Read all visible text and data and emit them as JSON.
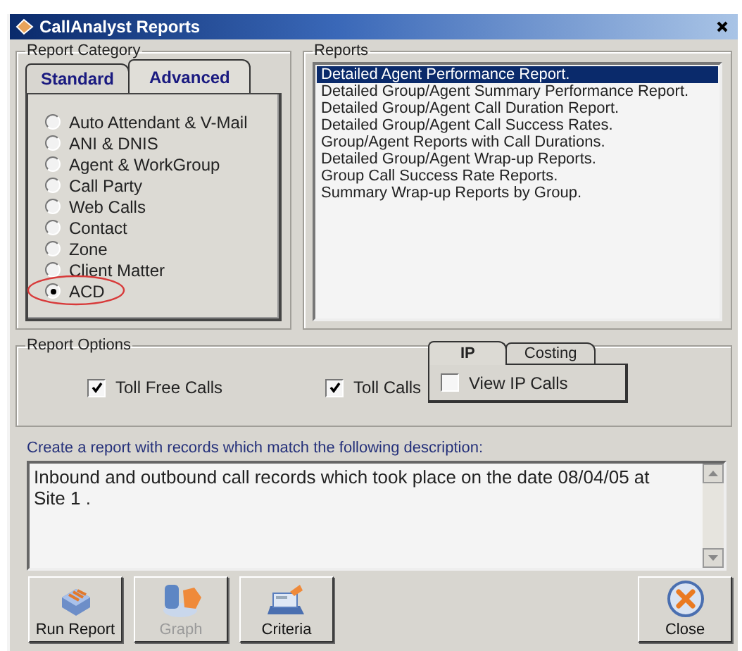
{
  "window": {
    "title": "CallAnalyst Reports"
  },
  "report_category": {
    "label": "Report Category",
    "tabs": [
      {
        "label": "Standard",
        "selected": false
      },
      {
        "label": "Advanced",
        "selected": true
      }
    ],
    "options": [
      {
        "label": "Auto Attendant & V-Mail",
        "selected": false
      },
      {
        "label": "ANI & DNIS",
        "selected": false
      },
      {
        "label": "Agent & WorkGroup",
        "selected": false
      },
      {
        "label": "Call Party",
        "selected": false
      },
      {
        "label": "Web Calls",
        "selected": false
      },
      {
        "label": "Contact",
        "selected": false
      },
      {
        "label": "Zone",
        "selected": false
      },
      {
        "label": "Client Matter",
        "selected": false
      },
      {
        "label": "ACD",
        "selected": true,
        "circled": true
      }
    ]
  },
  "reports": {
    "label": "Reports",
    "items": [
      {
        "label": "Detailed Agent Performance Report.",
        "selected": true
      },
      {
        "label": "Detailed Group/Agent Summary Performance Report.",
        "selected": false
      },
      {
        "label": "Detailed Group/Agent Call Duration Report.",
        "selected": false
      },
      {
        "label": "Detailed Group/Agent Call Success Rates.",
        "selected": false
      },
      {
        "label": "Group/Agent Reports with Call Durations.",
        "selected": false
      },
      {
        "label": "Detailed Group/Agent Wrap-up Reports.",
        "selected": false
      },
      {
        "label": "Group Call Success Rate Reports.",
        "selected": false
      },
      {
        "label": "Summary Wrap-up Reports by Group.",
        "selected": false
      }
    ]
  },
  "report_options": {
    "label": "Report Options",
    "checkboxes": [
      {
        "label": "Toll Free Calls",
        "checked": true
      },
      {
        "label": "Toll Calls",
        "checked": true
      }
    ],
    "tabs": [
      {
        "label": "IP",
        "selected": true
      },
      {
        "label": "Costing",
        "selected": false
      }
    ],
    "view_ip_calls": {
      "label": "View IP Calls",
      "checked": false
    }
  },
  "description": {
    "label": "Create a report with records which match the following description:",
    "value": "Inbound and outbound call records which took place on the date 08/04/05 at Site 1 ."
  },
  "buttons": [
    {
      "label": "Run Report",
      "kind": "run",
      "disabled": false
    },
    {
      "label": "Graph",
      "kind": "graph",
      "disabled": true
    },
    {
      "label": "Criteria",
      "kind": "criteria",
      "disabled": false
    },
    {
      "label": "Close",
      "kind": "close",
      "disabled": false
    }
  ]
}
